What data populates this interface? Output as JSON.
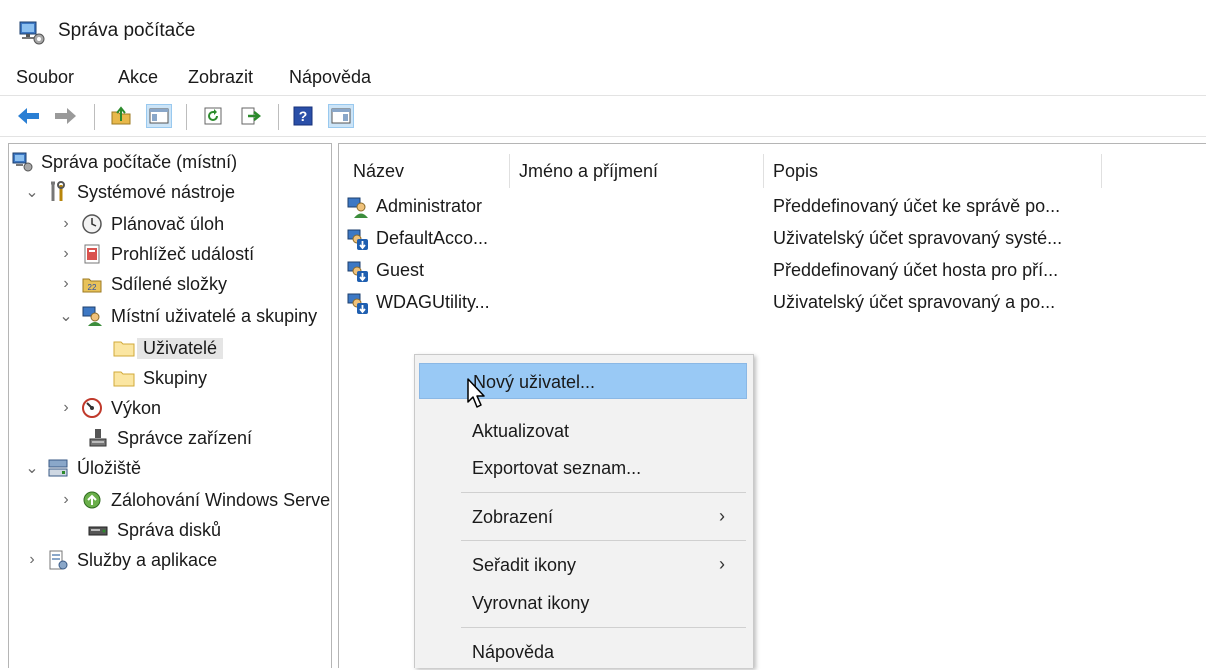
{
  "window": {
    "title": "Správa počítače",
    "icon": "computer-management-icon"
  },
  "menubar": {
    "items": [
      "Soubor",
      "Akce",
      "Zobrazit",
      "Nápověda"
    ]
  },
  "toolbar": {
    "buttons": [
      "back-arrow-icon",
      "forward-arrow-icon",
      "up-folder-icon",
      "show-hide-tree-icon",
      "refresh-icon",
      "export-list-icon",
      "help-icon",
      "show-hide-action-pane-icon"
    ]
  },
  "tree": {
    "items": [
      {
        "label": "Správa počítače (místní)",
        "icon": "computer-management-icon",
        "expander": ""
      },
      {
        "label": "Systémové nástroje",
        "icon": "tools-icon",
        "expander": "expanded"
      },
      {
        "label": "Plánovač úloh",
        "icon": "clock-icon",
        "expander": "collapsed"
      },
      {
        "label": "Prohlížeč událostí",
        "icon": "event-viewer-icon",
        "expander": "collapsed"
      },
      {
        "label": "Sdílené složky",
        "icon": "shared-folder-icon",
        "expander": "collapsed"
      },
      {
        "label": "Místní uživatelé a skupiny",
        "icon": "users-groups-icon",
        "expander": "expanded"
      },
      {
        "label": "Uživatelé",
        "icon": "folder-icon",
        "expander": "",
        "selected": true
      },
      {
        "label": "Skupiny",
        "icon": "folder-icon",
        "expander": ""
      },
      {
        "label": "Výkon",
        "icon": "performance-icon",
        "expander": "collapsed"
      },
      {
        "label": "Správce zařízení",
        "icon": "device-manager-icon",
        "expander": ""
      },
      {
        "label": "Úložiště",
        "icon": "storage-icon",
        "expander": "expanded"
      },
      {
        "label": "Zálohování Windows Server",
        "icon": "backup-icon",
        "expander": "collapsed"
      },
      {
        "label": "Správa disků",
        "icon": "disk-management-icon",
        "expander": ""
      },
      {
        "label": "Služby a aplikace",
        "icon": "services-icon",
        "expander": "collapsed"
      }
    ]
  },
  "list": {
    "columns": [
      "Název",
      "Jméno a příjmení",
      "Popis"
    ],
    "rows": [
      {
        "name": "Administrator",
        "full_name": "",
        "description": "Předdefinovaný účet ke správě po...",
        "icon": "user-icon"
      },
      {
        "name": "DefaultAcco...",
        "full_name": "",
        "description": "Uživatelský účet spravovaný systé...",
        "icon": "user-disabled-icon"
      },
      {
        "name": "Guest",
        "full_name": "",
        "description": "Předdefinovaný účet hosta pro pří...",
        "icon": "user-disabled-icon"
      },
      {
        "name": "WDAGUtility...",
        "full_name": "",
        "description": "Uživatelský účet spravovaný a po...",
        "icon": "user-disabled-icon"
      }
    ]
  },
  "context_menu": {
    "items": [
      {
        "label": "Nový uživatel...",
        "submenu": false,
        "highlighted": true
      },
      {
        "label": "Aktualizovat",
        "submenu": false
      },
      {
        "label": "Exportovat seznam...",
        "submenu": false
      },
      {
        "label": "Zobrazení",
        "submenu": true
      },
      {
        "label": "Seřadit ikony",
        "submenu": true
      },
      {
        "label": "Vyrovnat ikony",
        "submenu": false
      },
      {
        "label": "Nápověda",
        "submenu": false
      }
    ],
    "submenu_arrow": "›"
  },
  "colors": {
    "highlight": "#99c9f5",
    "selection": "#e5e5e5",
    "accent": "#0078d7"
  }
}
